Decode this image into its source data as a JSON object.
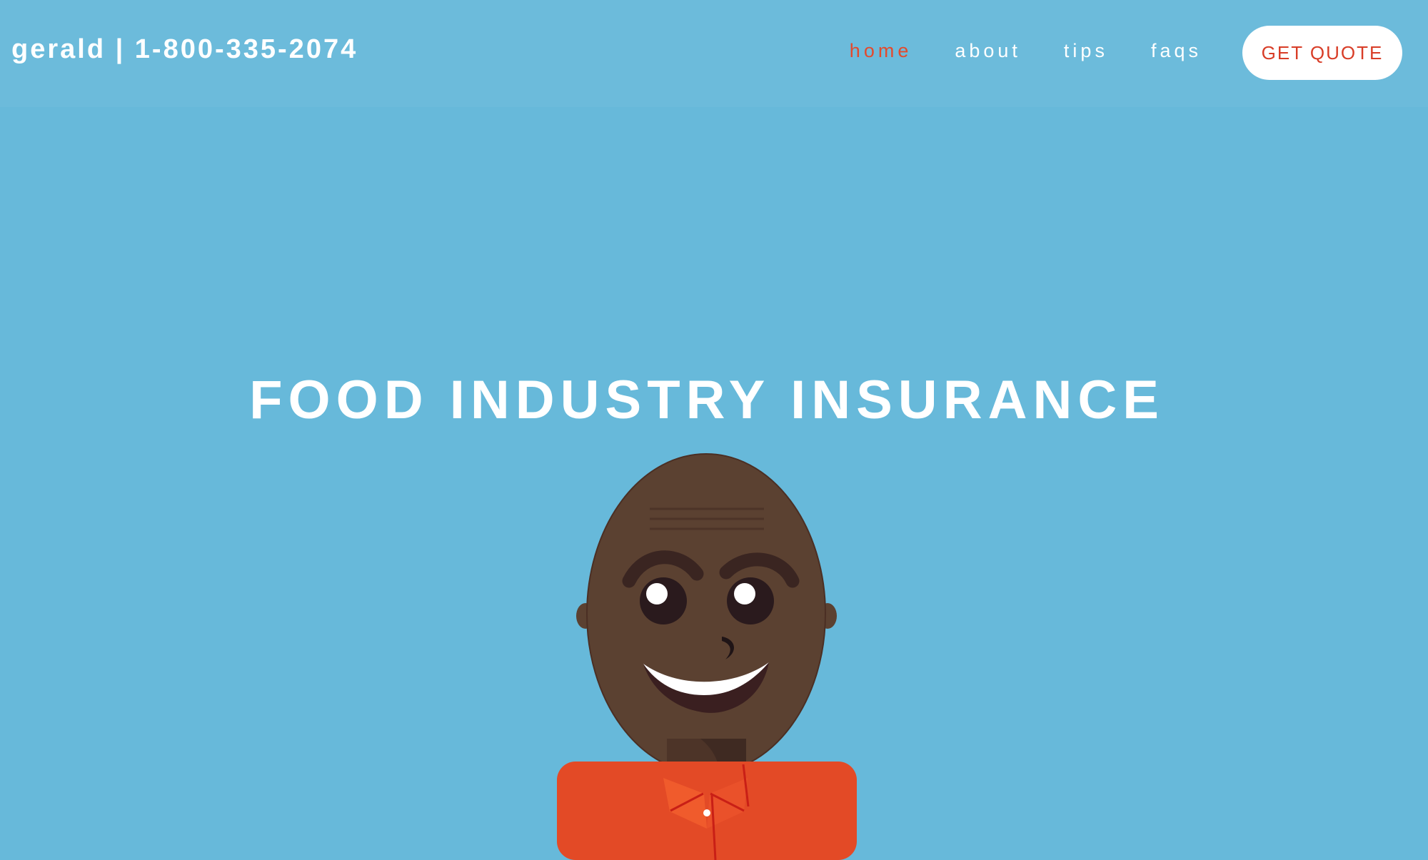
{
  "header": {
    "brand": "gerald | 1-800-335-2074",
    "nav": [
      {
        "label": "home",
        "active": true
      },
      {
        "label": "about",
        "active": false
      },
      {
        "label": "tips",
        "active": false
      },
      {
        "label": "faqs",
        "active": false
      }
    ],
    "cta_label": "GET QUOTE"
  },
  "hero": {
    "title": "FOOD INDUSTRY INSURANCE"
  },
  "colors": {
    "background": "#67b9da",
    "accent": "#e34a2d",
    "white": "#ffffff"
  }
}
